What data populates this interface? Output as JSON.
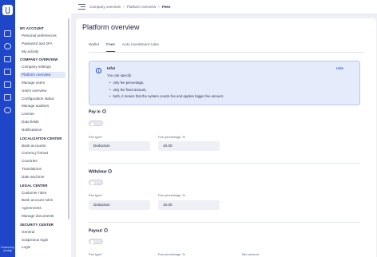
{
  "rail": {
    "powered_by": "Powered by Lendsqr"
  },
  "breadcrumb": [
    "Company overview",
    "Platform overview",
    "Fees"
  ],
  "sidebar": {
    "sections": [
      {
        "title": "MY ACCOUNT",
        "items": [
          {
            "label": "Personal preferences",
            "active": false
          },
          {
            "label": "Password and 2FA",
            "active": false
          },
          {
            "label": "My activity",
            "active": false
          }
        ]
      },
      {
        "title": "COMPANY OVERVIEW",
        "items": [
          {
            "label": "Company settings",
            "active": false
          },
          {
            "label": "Platform overview",
            "active": true
          },
          {
            "label": "Manage users",
            "active": false
          },
          {
            "label": "Users overview",
            "active": false
          },
          {
            "label": "Configuration status",
            "active": false
          },
          {
            "label": "Manage auditors",
            "active": false
          },
          {
            "label": "License",
            "active": false
          },
          {
            "label": "Data fields",
            "active": false
          },
          {
            "label": "Notifications",
            "active": false
          }
        ]
      },
      {
        "title": "LOCALIZATION CENTER",
        "items": [
          {
            "label": "Bank accounts",
            "active": false
          },
          {
            "label": "Currency format",
            "active": false
          },
          {
            "label": "Countries",
            "active": false
          },
          {
            "label": "Translations",
            "active": false
          },
          {
            "label": "Date and time",
            "active": false
          }
        ]
      },
      {
        "title": "LEGAL CENTER",
        "items": [
          {
            "label": "Customer roles",
            "active": false
          },
          {
            "label": "Bank account roles",
            "active": false
          },
          {
            "label": "Agreements",
            "active": false
          },
          {
            "label": "Manage documents",
            "active": false
          }
        ]
      },
      {
        "title": "SECURITY CENTER",
        "items": [
          {
            "label": "General",
            "active": false
          },
          {
            "label": "Suspicious login",
            "active": false
          },
          {
            "label": "Login",
            "active": false
          }
        ]
      }
    ]
  },
  "page": {
    "title": "Platform overview",
    "tabs": [
      {
        "label": "Wallet",
        "active": false
      },
      {
        "label": "Fees",
        "active": true
      },
      {
        "label": "Auto investment rules",
        "active": false
      }
    ]
  },
  "info": {
    "title": "Info!",
    "subtitle": "You can specify:",
    "items": [
      "only fee percentage,",
      "only fee fixed amount,",
      "both, it means that the system counts fee and applies bigger fee amount."
    ],
    "hide_label": "Hide"
  },
  "sections": [
    {
      "title": "Pay in",
      "fee_type_label": "Fee type*",
      "fee_type_value": "Deduction",
      "fee_pct_label": "Fee percentage, %",
      "fee_pct_value": "10.00",
      "min_amount_label": ""
    },
    {
      "title": "Withdraw",
      "fee_type_label": "Fee type*",
      "fee_type_value": "Deduction",
      "fee_pct_label": "Fee percentage, %",
      "fee_pct_value": "10.00",
      "min_amount_label": ""
    },
    {
      "title": "Payout",
      "fee_type_label": "Fee type*",
      "fee_type_value": "",
      "fee_pct_label": "Fee percentage, %",
      "fee_pct_value": "",
      "min_amount_label": "Min amount"
    }
  ],
  "colors": {
    "accent": "#1f46c8",
    "info_bg": "#e4ebfb",
    "page_bg": "#eef0f6"
  }
}
